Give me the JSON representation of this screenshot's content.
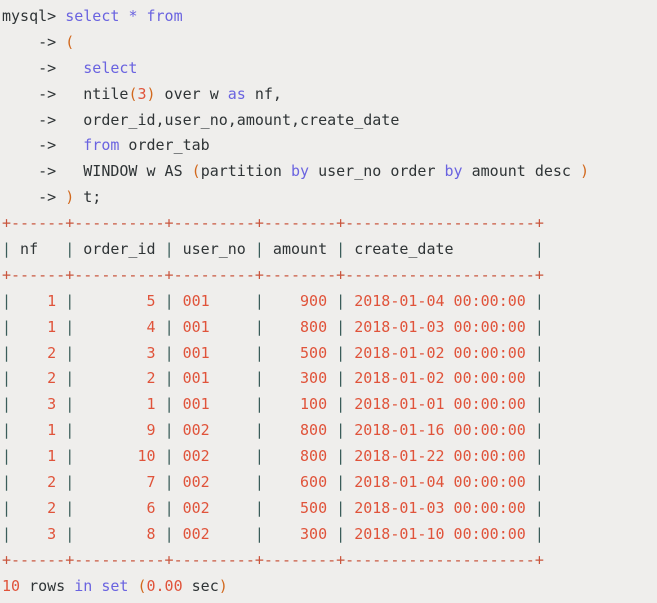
{
  "terminal": {
    "prompt": "mysql>",
    "continuation": "->",
    "query_lines": [
      {
        "prompt": "mysql>",
        "tokens": [
          {
            "t": " ",
            "c": "plain"
          },
          {
            "t": "select",
            "c": "kw"
          },
          {
            "t": " ",
            "c": "plain"
          },
          {
            "t": "*",
            "c": "kw"
          },
          {
            "t": " ",
            "c": "plain"
          },
          {
            "t": "from",
            "c": "kw"
          }
        ]
      },
      {
        "prompt": "    ->",
        "tokens": [
          {
            "t": " ",
            "c": "plain"
          },
          {
            "t": "(",
            "c": "punc"
          }
        ]
      },
      {
        "prompt": "    ->",
        "tokens": [
          {
            "t": "   ",
            "c": "plain"
          },
          {
            "t": "select",
            "c": "kw"
          }
        ]
      },
      {
        "prompt": "    ->",
        "tokens": [
          {
            "t": "   ntile",
            "c": "plain"
          },
          {
            "t": "(",
            "c": "punc"
          },
          {
            "t": "3",
            "c": "num"
          },
          {
            "t": ")",
            "c": "punc"
          },
          {
            "t": " over w ",
            "c": "plain"
          },
          {
            "t": "as",
            "c": "kw"
          },
          {
            "t": " nf,",
            "c": "plain"
          }
        ]
      },
      {
        "prompt": "    ->",
        "tokens": [
          {
            "t": "   order_id,user_no,amount,create_date",
            "c": "plain"
          }
        ]
      },
      {
        "prompt": "    ->",
        "tokens": [
          {
            "t": "   ",
            "c": "plain"
          },
          {
            "t": "from",
            "c": "kw"
          },
          {
            "t": " order_tab",
            "c": "plain"
          }
        ]
      },
      {
        "prompt": "    ->",
        "tokens": [
          {
            "t": "   WINDOW w AS ",
            "c": "plain"
          },
          {
            "t": "(",
            "c": "punc"
          },
          {
            "t": "partition ",
            "c": "plain"
          },
          {
            "t": "by",
            "c": "kw"
          },
          {
            "t": " user_no order ",
            "c": "plain"
          },
          {
            "t": "by",
            "c": "kw"
          },
          {
            "t": " amount desc ",
            "c": "plain"
          },
          {
            "t": ")",
            "c": "punc"
          }
        ]
      },
      {
        "prompt": "    ->",
        "tokens": [
          {
            "t": " ",
            "c": "plain"
          },
          {
            "t": ")",
            "c": "punc"
          },
          {
            "t": " t;",
            "c": "plain"
          }
        ]
      }
    ],
    "table": {
      "separator": "+------+----------+---------+--------+---------------------+",
      "columns": [
        {
          "name": "nf",
          "width": 6,
          "align": "right"
        },
        {
          "name": "order_id",
          "width": 10,
          "align": "right"
        },
        {
          "name": "user_no",
          "width": 9,
          "align": "left"
        },
        {
          "name": "amount",
          "width": 8,
          "align": "right"
        },
        {
          "name": "create_date",
          "width": 21,
          "align": "left"
        }
      ],
      "rows": [
        [
          "1",
          "5",
          "001",
          "900",
          "2018-01-04 00:00:00"
        ],
        [
          "1",
          "4",
          "001",
          "800",
          "2018-01-03 00:00:00"
        ],
        [
          "2",
          "3",
          "001",
          "500",
          "2018-01-02 00:00:00"
        ],
        [
          "2",
          "2",
          "001",
          "300",
          "2018-01-02 00:00:00"
        ],
        [
          "3",
          "1",
          "001",
          "100",
          "2018-01-01 00:00:00"
        ],
        [
          "1",
          "9",
          "002",
          "800",
          "2018-01-16 00:00:00"
        ],
        [
          "1",
          "10",
          "002",
          "800",
          "2018-01-22 00:00:00"
        ],
        [
          "2",
          "7",
          "002",
          "600",
          "2018-01-04 00:00:00"
        ],
        [
          "2",
          "6",
          "002",
          "500",
          "2018-01-03 00:00:00"
        ],
        [
          "3",
          "8",
          "002",
          "300",
          "2018-01-10 00:00:00"
        ]
      ]
    },
    "status": {
      "count": "10",
      "rows_word": "rows",
      "in_set": "in set",
      "open_paren": "(",
      "time": "0.00",
      "unit": "sec",
      "close_paren": ")"
    }
  }
}
